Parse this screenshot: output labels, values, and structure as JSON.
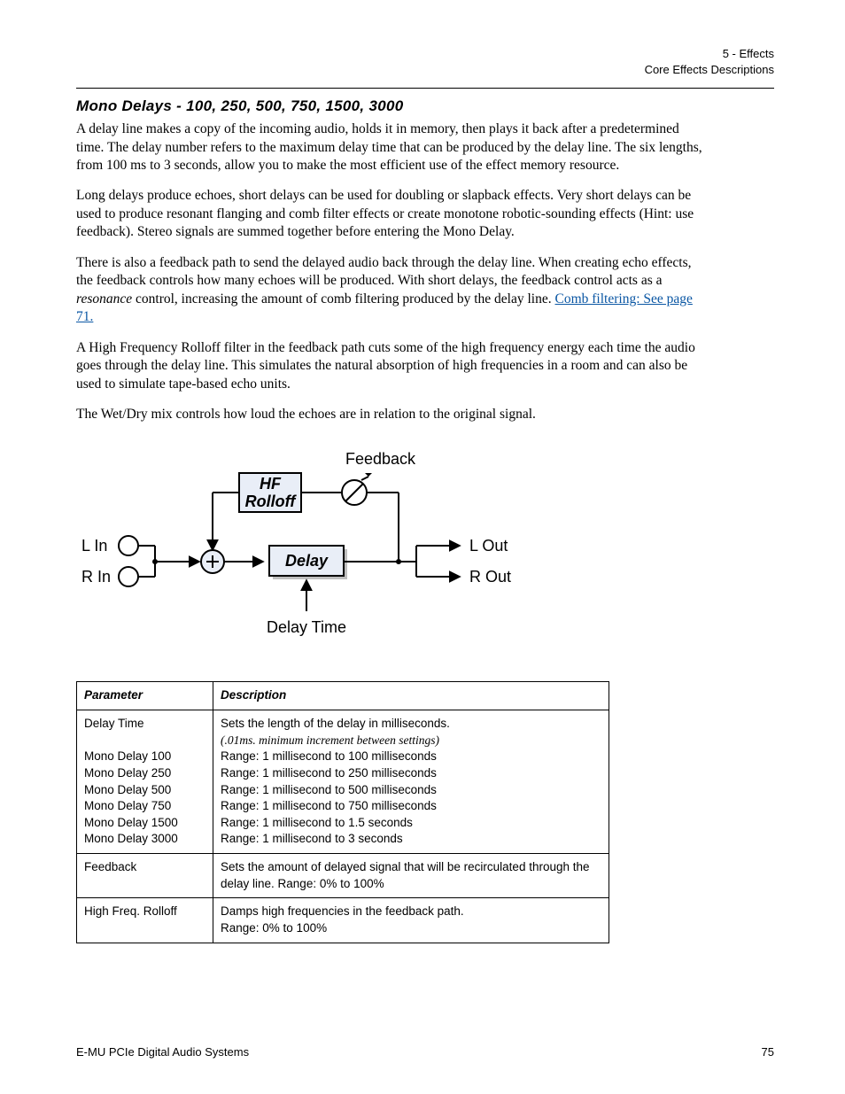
{
  "meta": {
    "chapter": "5 - Effects",
    "section": "Core Effects Descriptions"
  },
  "title": "Mono Delays - 100, 250, 500, 750, 1500, 3000",
  "paras": {
    "p1": "A delay line makes a copy of the incoming audio, holds it in memory, then plays it back after a predetermined time. The delay number refers to the maximum delay time that can be produced by the delay line. The six lengths, from 100 ms to 3 seconds, allow you to make the most efficient use of the effect memory resource.",
    "p2": "Long delays produce echoes, short delays can be used for doubling or slapback effects. Very short delays can be used to produce resonant flanging and comb filter effects or create monotone robotic-sounding effects (Hint: use feedback). Stereo signals are summed together before entering the Mono Delay.",
    "p3a": "There is also a feedback path to send the delayed audio back through the delay line. When creating echo effects, the feedback controls how many echoes will be produced. With short delays, the feedback control acts as a ",
    "p3b_em": "resonance",
    "p3c": " control, increasing the amount of comb filtering produced by the delay line. ",
    "p3_link": "Comb filtering: See page 71.",
    "p4": "A High Frequency Rolloff filter in the feedback path cuts some of the high frequency energy each time the audio goes through the delay line. This simulates the natural absorption of high frequencies in a room and can also be used to simulate tape-based echo units.",
    "p5": "The Wet/Dry mix controls how loud the echoes are in relation to the original signal."
  },
  "diagram": {
    "feedback": "Feedback",
    "hf": "HF",
    "rolloff": "Rolloff",
    "delay": "Delay",
    "lin": "L In",
    "rin": "R In",
    "lout": "L Out",
    "rout": "R Out",
    "delaytime": "Delay Time"
  },
  "table": {
    "h_param": "Parameter",
    "h_desc": "Description",
    "r1_param": "Delay Time",
    "r1_desc": "Sets the length of the delay in milliseconds.",
    "r1_em": "(.01ms. minimum increment between settings)",
    "r2_param": "Mono Delay 100",
    "r2_desc": "Range: 1 millisecond to 100 milliseconds",
    "r3_param": "Mono Delay 250",
    "r3_desc": "Range: 1 millisecond to 250 milliseconds",
    "r4_param": "Mono Delay 500",
    "r4_desc": "Range: 1 millisecond to 500 milliseconds",
    "r5_param": "Mono Delay 750",
    "r5_desc": "Range: 1 millisecond to 750 milliseconds",
    "r6_param": "Mono Delay 1500",
    "r6_desc": "Range: 1 millisecond to 1.5 seconds",
    "r7_param": "Mono Delay 3000",
    "r7_desc": "Range: 1 millisecond to 3 seconds",
    "r8_param": "Feedback",
    "r8_desc": "Sets the amount of delayed signal that will be recirculated through the delay line. Range: 0% to 100%",
    "r9_param": "High Freq. Rolloff",
    "r9_desc": "Damps high frequencies in the feedback path.",
    "r9_desc2": "Range: 0% to 100%"
  },
  "footer": {
    "left": "E-MU PCIe Digital Audio Systems",
    "right": "75"
  }
}
